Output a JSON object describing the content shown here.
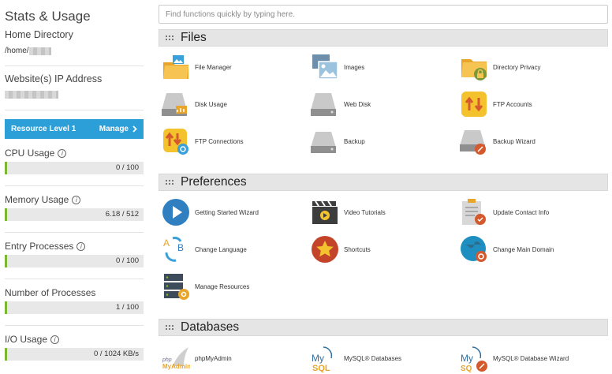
{
  "sidebar": {
    "title": "Stats & Usage",
    "home_dir_label": "Home Directory",
    "home_dir_value": "/home/",
    "ip_label": "Website(s) IP Address",
    "resource": {
      "label": "Resource Level 1",
      "manage": "Manage"
    },
    "stats": [
      {
        "label": "CPU Usage",
        "value": "0 / 100",
        "fraction": 0
      },
      {
        "label": "Memory Usage",
        "value": "6.18 / 512",
        "fraction": 0.012
      },
      {
        "label": "Entry Processes",
        "value": "0 / 100",
        "fraction": 0
      },
      {
        "label": "Number of Processes",
        "value": "1 / 100",
        "fraction": 0.01
      },
      {
        "label": "I/O Usage",
        "value": "0 / 1024 KB/s",
        "fraction": 0
      }
    ]
  },
  "search": {
    "placeholder": "Find functions quickly by typing here."
  },
  "sections": {
    "files": {
      "title": "Files",
      "items": [
        "File Manager",
        "Images",
        "Directory Privacy",
        "Disk Usage",
        "Web Disk",
        "FTP Accounts",
        "FTP Connections",
        "Backup",
        "Backup Wizard"
      ]
    },
    "preferences": {
      "title": "Preferences",
      "items": [
        "Getting Started Wizard",
        "Video Tutorials",
        "Update Contact Info",
        "Change Language",
        "Shortcuts",
        "Change Main Domain",
        "Manage Resources"
      ]
    },
    "databases": {
      "title": "Databases",
      "items": [
        "phpMyAdmin",
        "MySQL® Databases",
        "MySQL® Database Wizard"
      ]
    }
  },
  "colors": {
    "accent": "#2d9fd8",
    "usage_fill": "#7cb82f",
    "section_bg": "#e5e5e5"
  }
}
